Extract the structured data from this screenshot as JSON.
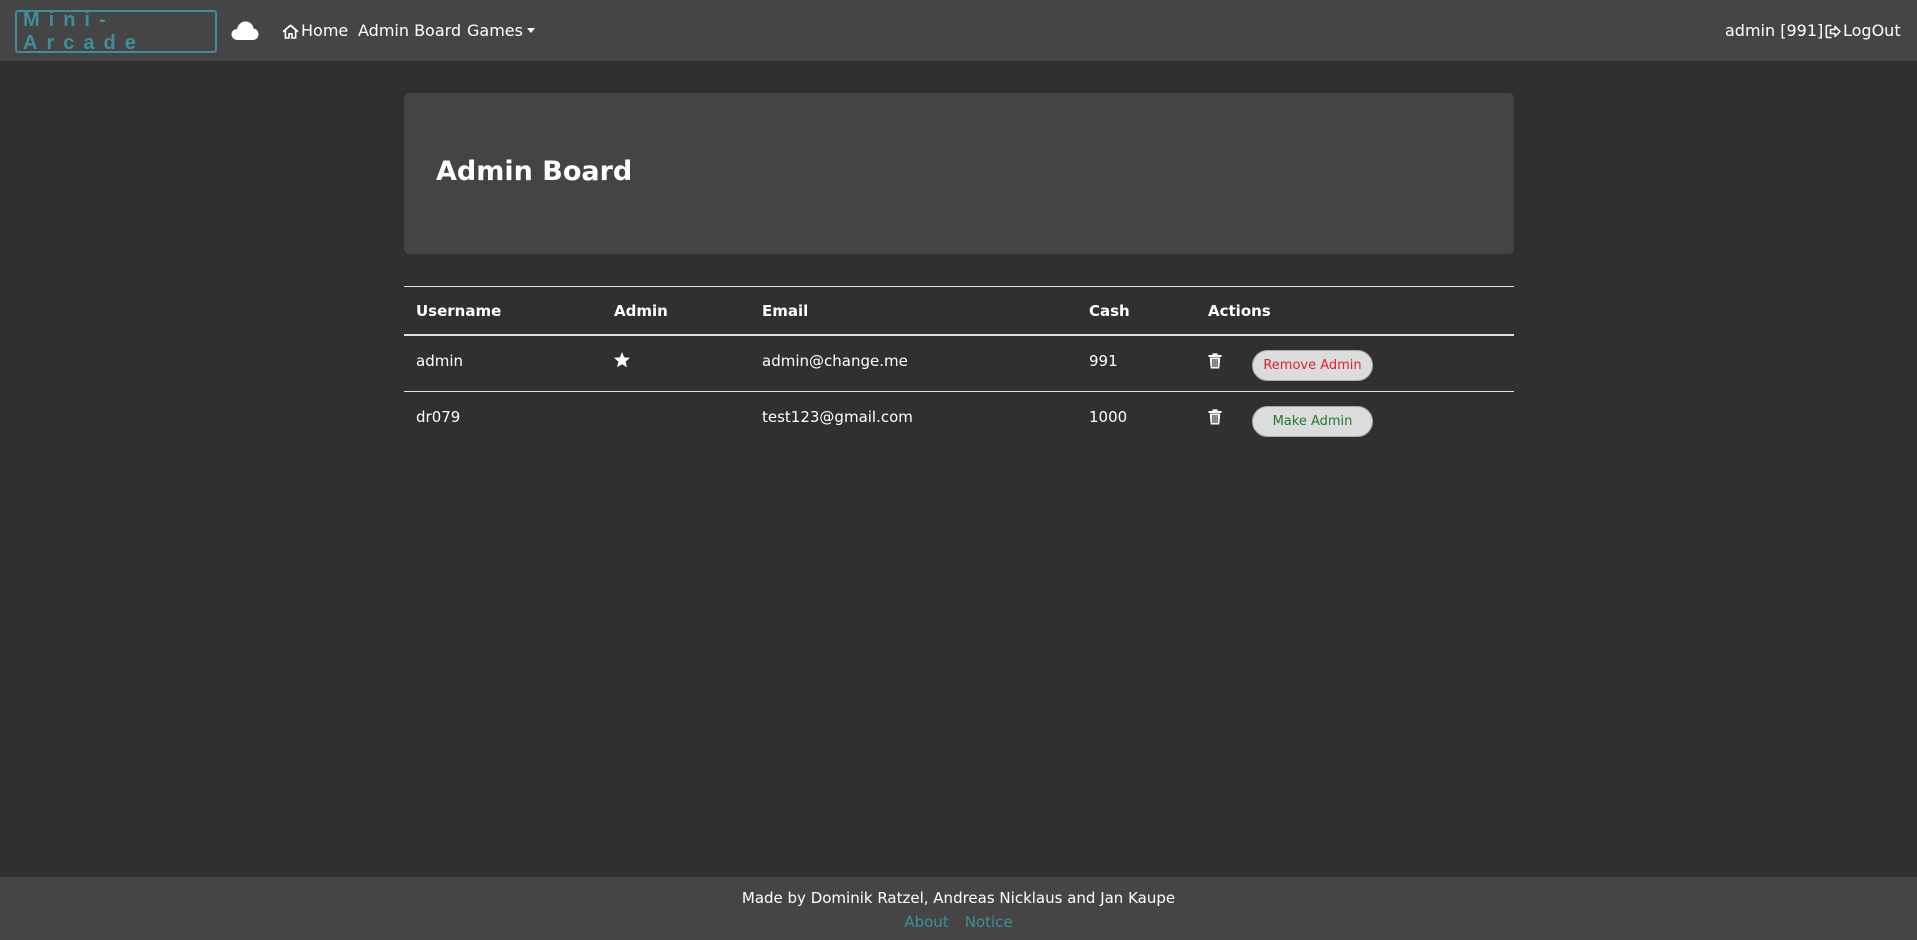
{
  "colors": {
    "background": "#303030",
    "navbar": "#454545",
    "jumbotron": "#444444",
    "brand_accent": "#3d8f99",
    "remove_text": "#e0202a",
    "make_text": "#1e7a2e"
  },
  "navbar": {
    "brand": "Mini-Arcade",
    "cloud_icon": "cloud-icon",
    "home_icon": "home-icon",
    "home_label": "Home",
    "admin_board_label": "Admin Board",
    "games_label": "Games",
    "user_label": "admin [991]",
    "logout_icon": "logout-icon",
    "logout_label": "LogOut"
  },
  "jumbotron": {
    "title": "Admin Board"
  },
  "table": {
    "headers": [
      "Username",
      "Admin",
      "Email",
      "Cash",
      "Actions"
    ],
    "rows": [
      {
        "username": "admin",
        "is_admin": true,
        "admin_icon": "star-icon",
        "email": "admin@change.me",
        "cash": "991",
        "delete_icon": "trash-icon",
        "action_label": "Remove Admin"
      },
      {
        "username": "dr079",
        "is_admin": false,
        "admin_icon": "",
        "email": "test123@gmail.com",
        "cash": "1000",
        "delete_icon": "trash-icon",
        "action_label": "Make Admin"
      }
    ]
  },
  "footer": {
    "credit": "Made by Dominik Ratzel, Andreas Nicklaus and Jan Kaupe",
    "links": [
      "About",
      "Notice"
    ]
  }
}
